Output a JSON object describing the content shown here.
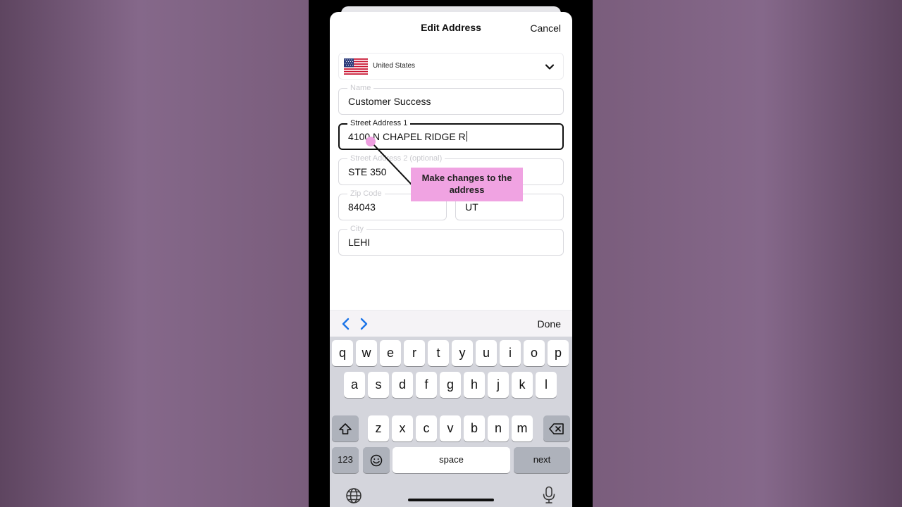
{
  "header": {
    "title": "Edit Address",
    "cancel_label": "Cancel"
  },
  "country": {
    "name": "United States",
    "flag_icon": "us-flag-icon"
  },
  "fields": {
    "name": {
      "label": "Name",
      "value": "Customer Success"
    },
    "street1": {
      "label": "Street Address 1",
      "value": "4100 N CHAPEL RIDGE R"
    },
    "street2": {
      "label": "Street Address 2 (optional)",
      "value": "STE 350"
    },
    "zip": {
      "label": "Zip Code",
      "value": "84043"
    },
    "state": {
      "value": "UT"
    },
    "city": {
      "label": "City",
      "value": "LEHI"
    }
  },
  "callout": {
    "text": "Make changes to the address",
    "color": "#f0a3e2"
  },
  "accessory": {
    "done_label": "Done",
    "accent": "#1a73e8"
  },
  "keyboard": {
    "row1": [
      "q",
      "w",
      "e",
      "r",
      "t",
      "y",
      "u",
      "i",
      "o",
      "p"
    ],
    "row2": [
      "a",
      "s",
      "d",
      "f",
      "g",
      "h",
      "j",
      "k",
      "l"
    ],
    "row3": [
      "z",
      "x",
      "c",
      "v",
      "b",
      "n",
      "m"
    ],
    "numbers_label": "123",
    "space_label": "space",
    "next_label": "next"
  }
}
